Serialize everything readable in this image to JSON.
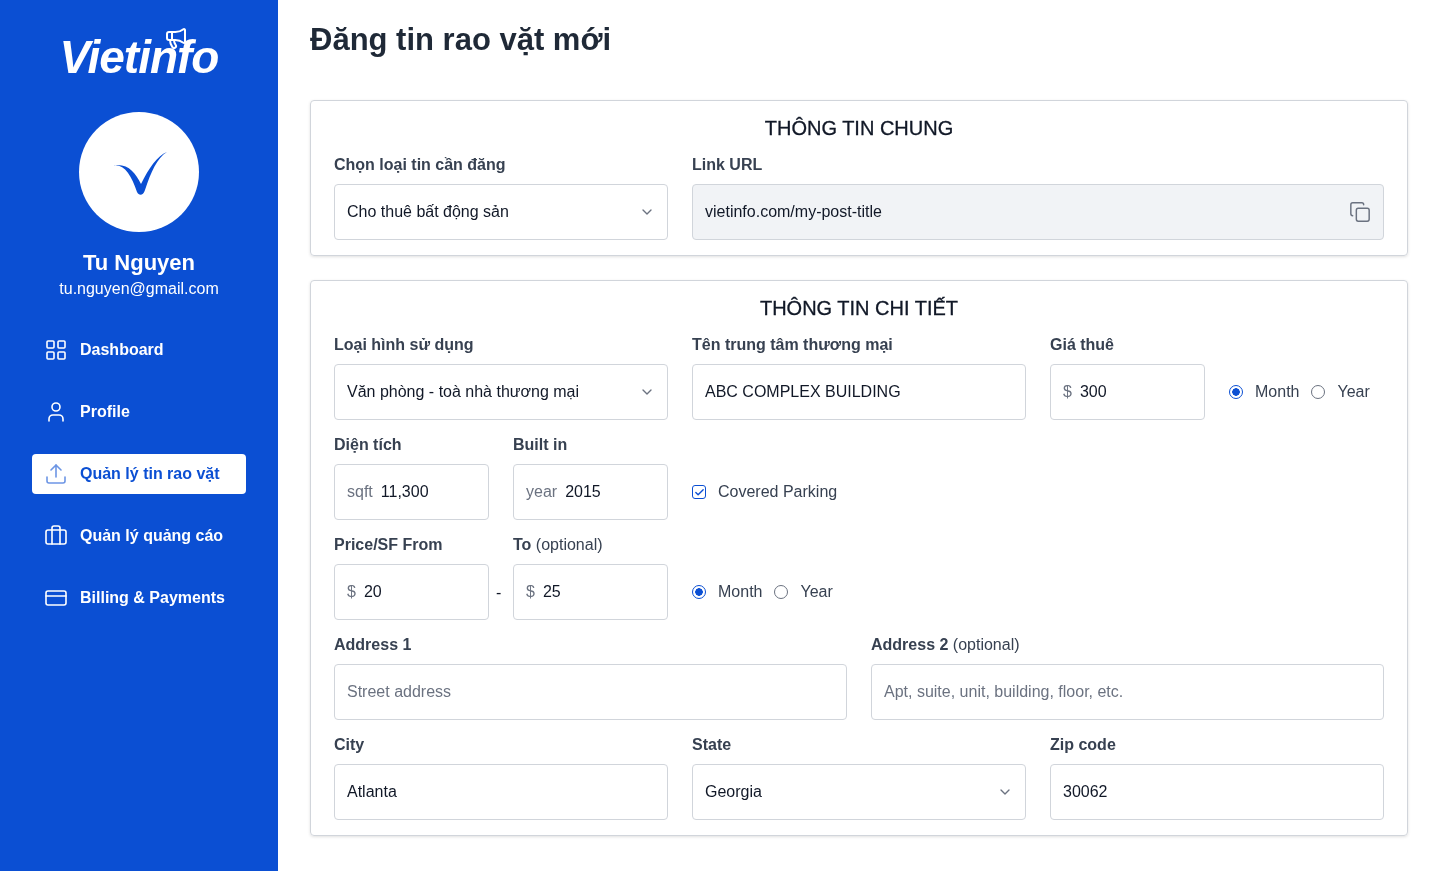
{
  "sidebar": {
    "logo": "Vietinfo",
    "user": {
      "name": "Tu Nguyen",
      "email": "tu.nguyen@gmail.com"
    },
    "nav": [
      {
        "label": "Dashboard",
        "selected": false
      },
      {
        "label": "Profile",
        "selected": false
      },
      {
        "label": "Quản lý tin rao vặt",
        "selected": true
      },
      {
        "label": "Quản lý quảng cáo",
        "selected": false
      },
      {
        "label": "Billing & Payments",
        "selected": false
      }
    ]
  },
  "page_title": "Đăng tin rao vặt mới",
  "cards": [
    {
      "title": "THÔNG TIN CHUNG",
      "rows": [
        [
          {
            "kind": "select",
            "label": "Chọn loại tin cần đăng",
            "value": "Cho thuê bất động sản"
          },
          {
            "kind": "copy",
            "label": "Link URL",
            "value": "vietinfo.com/my-post-title"
          }
        ]
      ]
    },
    {
      "title": "THÔNG TIN CHI TIẾT",
      "rows": [
        [
          {
            "kind": "select",
            "label": "Loại hình sử dụng",
            "value": "Văn phòng - toà nhà thương mại"
          },
          {
            "kind": "text",
            "label": "Tên trung tâm thương mại",
            "value": "ABC COMPLEX BUILDING"
          },
          {
            "kind": "unit",
            "label": "Giá thuê",
            "prefix": "$",
            "value": "300"
          },
          {
            "kind": "radios",
            "options": [
              {
                "label": "Month",
                "selected": true
              },
              {
                "label": "Year",
                "selected": false
              }
            ]
          }
        ],
        [
          {
            "kind": "unit",
            "label": "Diện tích",
            "prefix": "sqft",
            "value": "11,300"
          },
          {
            "kind": "unit",
            "label": "Built in",
            "prefix": "year",
            "value": "2015"
          },
          {
            "kind": "checkbox",
            "label": "Covered Parking",
            "checked": true
          }
        ],
        [
          {
            "kind": "unit",
            "label": "Price/SF From",
            "prefix": "$",
            "value": "20"
          },
          {
            "kind": "unit",
            "label": "To",
            "note": "(optional)",
            "dash": "-",
            "prefix": "$",
            "value": "25"
          },
          {
            "kind": "radios",
            "options": [
              {
                "label": "Month",
                "selected": true
              },
              {
                "label": "Year",
                "selected": false
              }
            ]
          }
        ],
        [
          {
            "kind": "text",
            "label": "Address 1",
            "placeholder": "Street address"
          },
          {
            "kind": "text",
            "label": "Address 2",
            "note": "(optional)",
            "placeholder": "Apt, suite, unit, building, floor, etc."
          }
        ],
        [
          {
            "kind": "text",
            "label": "City",
            "value": "Atlanta"
          },
          {
            "kind": "select",
            "label": "State",
            "value": "Georgia"
          },
          {
            "kind": "text",
            "label": "Zip code",
            "value": "30062"
          }
        ]
      ]
    }
  ]
}
